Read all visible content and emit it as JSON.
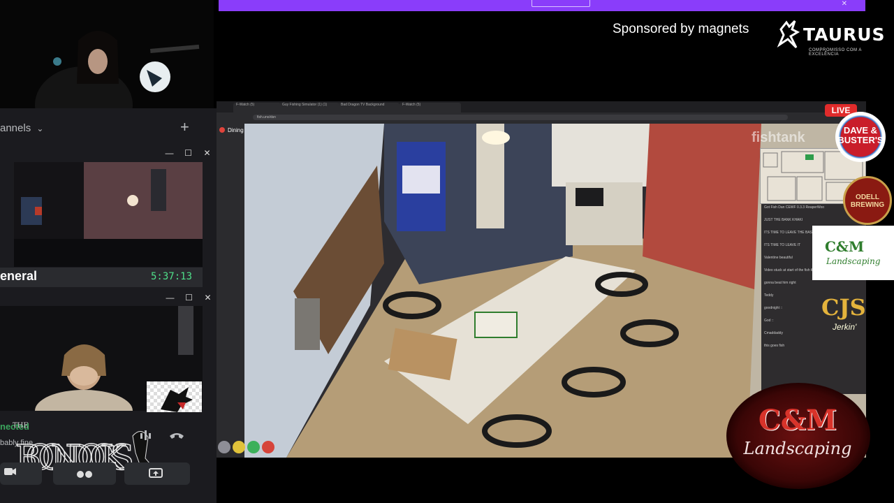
{
  "banner": {
    "close_glyph": "✕"
  },
  "sponsor": {
    "text": "Sponsored by magnets"
  },
  "taurus": {
    "name": "TAURUS",
    "tagline": "COMPROMISSO COM A EXCELÊNCIA"
  },
  "discord": {
    "channels_label": "annels",
    "chevron_glyph": "⌄",
    "add_glyph": "+",
    "window_controls": [
      "—",
      "☐",
      "✕"
    ],
    "general_label": "eneral",
    "timer": "5:37:13",
    "connected_label": "nected",
    "connected_sub": "bably fine",
    "boondocks_logo_text": "THE BOONDOCKS"
  },
  "browser": {
    "tabs": [
      "F-Watch (5)",
      "Guy Fishing Simulator (1) (1)",
      "Bad Dragon TV Background",
      "F-Watch (5)"
    ],
    "url": "fish.uno/dsn",
    "room_label": "Dining Room"
  },
  "fishtank_watermark": "fishtank",
  "live_badge": "LIVE",
  "chat": {
    "lines": [
      {
        "user": "",
        "text": "Got Fish Dan CEWF 0.3.3 ReaperWoo"
      },
      {
        "user": "",
        "text": "JUST THE BANK KHAKI"
      },
      {
        "user": "",
        "text": "ITS TIME TO LEAVE THE BASEMENT"
      },
      {
        "user": "",
        "text": "ITS TIME TO LEAVE IT"
      },
      {
        "user": "",
        "text": "Valentine beautiful"
      },
      {
        "user": "",
        "text": "Video stuck at start of the fish then where"
      },
      {
        "user": "",
        "text": "gonna beat him right"
      },
      {
        "user": "",
        "text": "Teddy"
      },
      {
        "user": "",
        "text": "goodnight ::"
      },
      {
        "user": "",
        "text": "God ::"
      },
      {
        "user": "",
        "text": "Cmaddaddy"
      },
      {
        "user": "",
        "text": "this goes fish"
      }
    ]
  },
  "logos": {
    "dave_busters": [
      "DAVE &",
      "BUSTER'S"
    ],
    "odell": [
      "ODELL",
      "BREWING"
    ],
    "cm_small": [
      "C&M",
      "Landscaping"
    ],
    "cjs": [
      "CJS",
      "Jerkin'"
    ],
    "cm_large": [
      "C&M",
      "Landscaping"
    ]
  }
}
